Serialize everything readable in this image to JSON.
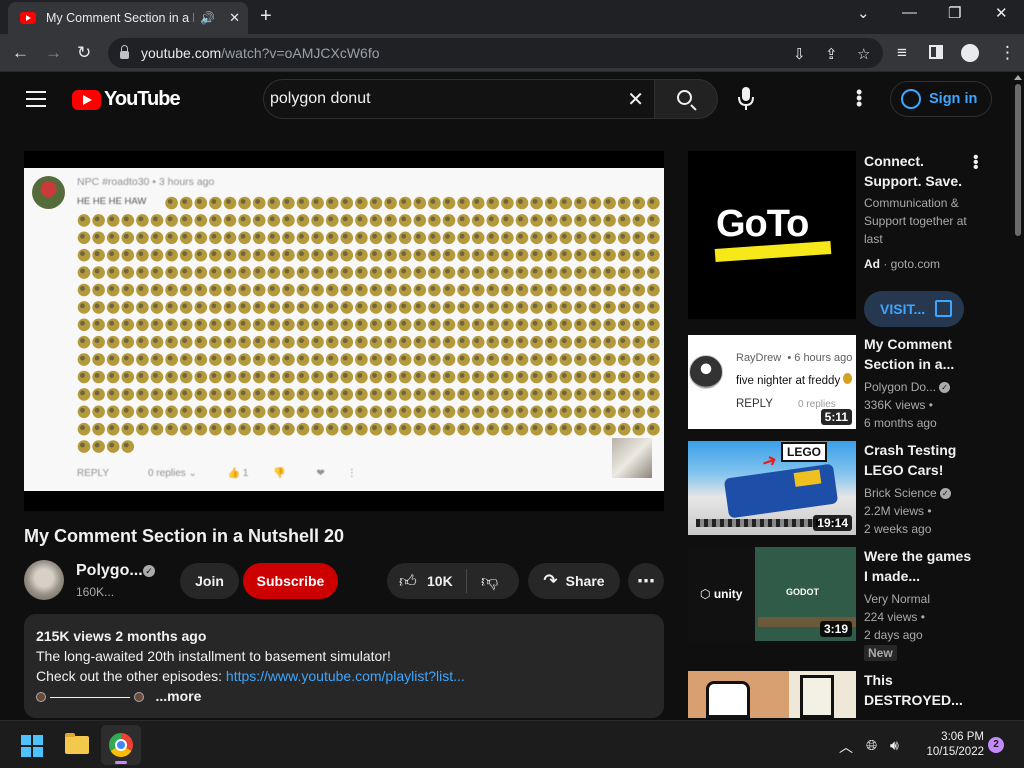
{
  "browser": {
    "tab_title": "My Comment Section in a N",
    "address_host": "youtube.com",
    "address_path": "/watch?v=oAMJCXcW6fo"
  },
  "youtube": {
    "logo_text": "YouTube",
    "search_query": "polygon donut",
    "signin_label": "Sign in"
  },
  "video_frame": {
    "comment_author": "NPC #roadto30",
    "comment_time": "3 hours ago",
    "comment_text": "HE HE HE HAW",
    "reply_label": "REPLY",
    "replies_label": "0 replies",
    "like_count": "1",
    "emoji_color": "#b59a3c"
  },
  "video": {
    "title": "My Comment Section in a Nutshell 20",
    "channel_name": "Polygo...",
    "subscribers": "160K...",
    "join_label": "Join",
    "subscribe_label": "Subscribe",
    "like_count": "10K",
    "share_label": "Share"
  },
  "description": {
    "meta": "215K views  2 months ago",
    "line1": "The long-awaited 20th installment to basement simulator!",
    "line2_prefix": "Check out the other episodes: ",
    "link": "https://www.youtube.com/playlist?list...",
    "more": "...more"
  },
  "ad": {
    "brand": "GoTo",
    "title": "Connect. Support. Save.",
    "desc": "Communication & Support together at last",
    "badge": "Ad",
    "domain": "goto.com",
    "visit_label": "VISIT..."
  },
  "recommendations": [
    {
      "title": "My Comment Section in a...",
      "channel": "Polygon Do...",
      "views": "336K views •",
      "age": "6 months ago",
      "duration": "5:11",
      "thumb_name": "RayDrew",
      "thumb_time": "• 6 hours ago",
      "thumb_text": "five nighter at freddy",
      "thumb_reply": "REPLY",
      "thumb_replies": "0 replies"
    },
    {
      "title": "Crash Testing LEGO Cars!",
      "channel": "Brick Science",
      "views": "2.2M views •",
      "age": "2 weeks ago",
      "duration": "19:14",
      "thumb_label": "LEGO"
    },
    {
      "title": "Were the games I made...",
      "channel": "Very Normal",
      "views": "224 views •",
      "age": "2 days ago",
      "duration": "3:19",
      "badge": "New",
      "thumb_left": "unity",
      "thumb_right": "GODOT"
    },
    {
      "title": "This DESTROYED..."
    }
  ],
  "taskbar": {
    "time": "3:06 PM",
    "date": "10/15/2022",
    "notifications": "2"
  }
}
